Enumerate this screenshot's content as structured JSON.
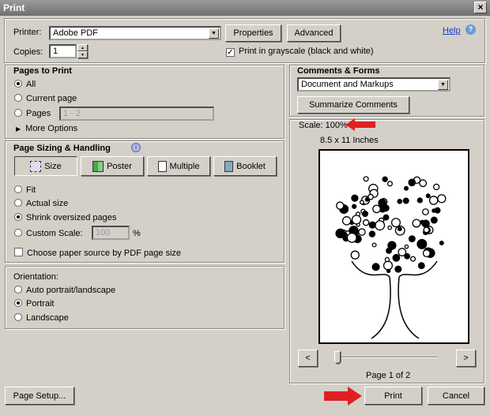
{
  "window": {
    "title": "Print",
    "close": "×"
  },
  "printer": {
    "label": "Printer:",
    "value": "Adobe PDF",
    "properties": "Properties",
    "advanced": "Advanced",
    "help": "Help",
    "copies_label": "Copies:",
    "copies": "1",
    "grayscale_label": "Print in grayscale (black and white)",
    "grayscale": true
  },
  "pages": {
    "title": "Pages to Print",
    "all": "All",
    "current": "Current page",
    "pages": "Pages",
    "range_placeholder": "1 - 2",
    "more": "More Options",
    "selected": "All"
  },
  "sizing": {
    "title": "Page Sizing & Handling",
    "tabs": [
      "Size",
      "Poster",
      "Multiple",
      "Booklet"
    ],
    "active_tab": "Size",
    "fit": "Fit",
    "actual": "Actual size",
    "shrink": "Shrink oversized pages",
    "custom": "Custom Scale:",
    "custom_value": "100",
    "percent": "%",
    "paper_source": "Choose paper source by PDF page size",
    "selected": "Shrink oversized pages"
  },
  "orientation": {
    "title": "Orientation:",
    "auto": "Auto portrait/landscape",
    "portrait": "Portrait",
    "landscape": "Landscape",
    "selected": "Portrait"
  },
  "comments": {
    "title": "Comments & Forms",
    "value": "Document and Markups",
    "summarize": "Summarize Comments"
  },
  "preview": {
    "scale": "Scale: 100%",
    "size": "8.5 x 11 Inches",
    "prev": "<",
    "next": ">",
    "page": "Page 1 of 2",
    "current_page": 1,
    "total_pages": 2
  },
  "footer": {
    "page_setup": "Page Setup...",
    "print": "Print",
    "cancel": "Cancel"
  },
  "colors": {
    "annotation_arrow": "#e02020",
    "title_bar": "#7a7a7a"
  }
}
